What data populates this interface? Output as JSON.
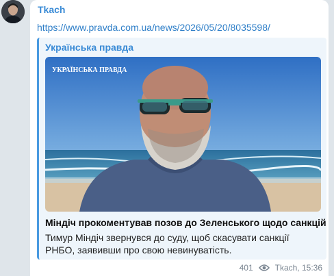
{
  "message": {
    "author": "Tkach",
    "link": "https://www.pravda.com.ua/news/2026/05/20/8035598/",
    "preview": {
      "site_name": "Українська правда",
      "image_watermark": "УКРАЇНСЬКА ПРАВДА",
      "title": "Міндіч прокоментував позов до Зеленського щодо санкцій",
      "description": "Тимур Міндіч звернувся до суду, щоб скасувати санкції РНБО, заявивши про свою невинуватість."
    },
    "views": "401",
    "signature": "Tkach, 15:36"
  },
  "icons": {
    "views": "eye-icon"
  },
  "colors": {
    "accent": "#3a8bd6",
    "link": "#2f7fc8",
    "preview_bar": "#4a9ae0"
  }
}
